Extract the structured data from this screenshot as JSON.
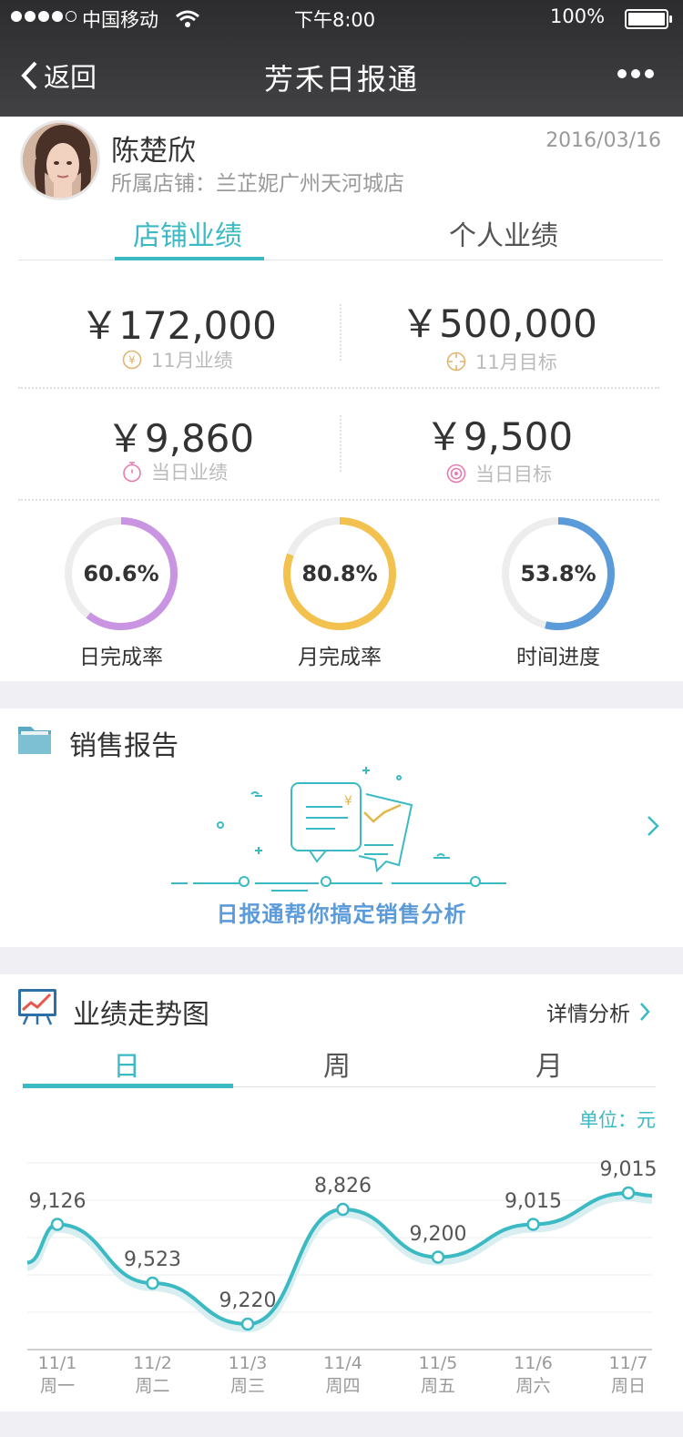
{
  "status": {
    "carrier": "中国移动",
    "time": "下午8:00",
    "battery": "100%"
  },
  "nav": {
    "back": "返回",
    "title": "芳禾日报通"
  },
  "profile": {
    "name": "陈楚欣",
    "date": "2016/03/16",
    "store": "所属店铺：兰芷妮广州天河城店"
  },
  "perf_tabs": [
    "店铺业绩",
    "个人业绩"
  ],
  "stats": {
    "month_amount": "￥172,000",
    "month_label": "11月业绩",
    "month_target": "￥500,000",
    "month_target_label": "11月目标",
    "day_amount": "￥9,860",
    "day_label": "当日业绩",
    "day_target": "￥9,500",
    "day_target_label": "当日目标"
  },
  "rings": [
    {
      "value": "60.6%",
      "label": "日完成率",
      "fraction": 0.606,
      "color": "#c995e3"
    },
    {
      "value": "80.8%",
      "label": "月完成率",
      "fraction": 0.808,
      "color": "#f2c14e"
    },
    {
      "value": "53.8%",
      "label": "时间进度",
      "fraction": 0.538,
      "color": "#5b9bd9"
    }
  ],
  "report": {
    "title": "销售报告",
    "banner": "日报通帮你搞定销售分析"
  },
  "trend": {
    "title": "业绩走势图",
    "detail": "详情分析",
    "periods": [
      "日",
      "周",
      "月"
    ],
    "unit": "单位：元"
  },
  "chart_data": {
    "type": "line",
    "categories": [
      "11/1 周一",
      "11/2 周二",
      "11/3 周三",
      "11/4 周四",
      "11/5 周五",
      "11/6 周六",
      "11/7 周日"
    ],
    "x_dates": [
      "11/1",
      "11/2",
      "11/3",
      "11/4",
      "11/5",
      "11/6",
      "11/7"
    ],
    "x_days": [
      "周一",
      "周二",
      "周三",
      "周四",
      "周五",
      "周六",
      "周日"
    ],
    "labels": [
      "9,126",
      "9,523",
      "9,220",
      "8,826",
      "9,200",
      "9,015",
      "9,015"
    ],
    "level": [
      0.77,
      0.34,
      0.04,
      0.88,
      0.53,
      0.77,
      1.0
    ],
    "color": "#3bbac3",
    "grid": true
  }
}
